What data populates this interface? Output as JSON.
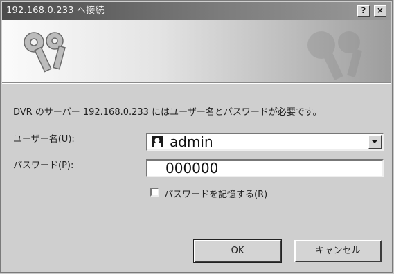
{
  "window": {
    "title": "192.168.0.233 へ接続",
    "help_label": "?",
    "close_label": "×",
    "banner_icon": "keys-icon"
  },
  "dialog": {
    "message": "DVR のサーバー 192.168.0.233 にはユーザー名とパスワードが必要です。",
    "username_label": "ユーザー名(U):",
    "username_value": "admin",
    "password_label": "パスワード(P):",
    "password_value": "000000",
    "remember_label": "パスワードを記憶する(R)",
    "remember_checked": false
  },
  "buttons": {
    "ok": "OK",
    "cancel": "キャンセル"
  }
}
